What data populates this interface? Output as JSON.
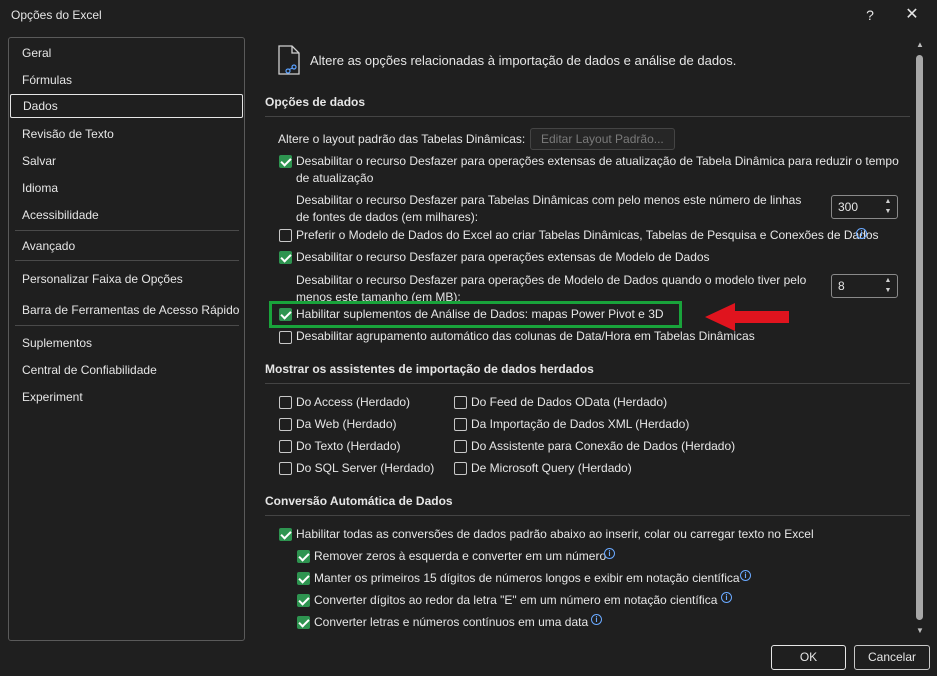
{
  "window": {
    "title": "Opções do Excel",
    "help_glyph": "?",
    "close_glyph": "✕"
  },
  "sidebar": {
    "items": [
      {
        "label": "Geral"
      },
      {
        "label": "Fórmulas"
      },
      {
        "label": "Dados",
        "active": true
      },
      {
        "label": "Revisão de Texto"
      },
      {
        "label": "Salvar"
      },
      {
        "label": "Idioma"
      },
      {
        "label": "Acessibilidade"
      },
      {
        "label": "Avançado"
      },
      {
        "label": "Personalizar Faixa de Opções"
      },
      {
        "label": "Barra de Ferramentas de Acesso Rápido"
      },
      {
        "label": "Suplementos"
      },
      {
        "label": "Central de Confiabilidade"
      },
      {
        "label": "Experiment"
      }
    ]
  },
  "main": {
    "intro": "Altere as opções relacionadas à importação de dados e análise de dados.",
    "data_options": {
      "heading": "Opções de dados",
      "pivot_layout_label": "Altere o layout padrão das Tabelas Dinâmicas:",
      "edit_layout_button": "Editar Layout Padrão...",
      "disable_undo_refresh": {
        "checked": true,
        "label": "Desabilitar o recurso Desfazer para operações extensas de atualização de Tabela Dinâmica para reduzir o tempo de atualização"
      },
      "disable_undo_rows_label": "Desabilitar o recurso Desfazer para Tabelas Dinâmicas com pelo menos este número de linhas de fontes de dados (em milhares):",
      "rows_value": "300",
      "prefer_data_model": {
        "checked": false,
        "label": "Preferir o Modelo de Dados do Excel ao criar Tabelas Dinâmicas, Tabelas de Pesquisa e Conexões de Dados"
      },
      "disable_undo_data_model": {
        "checked": true,
        "label": "Desabilitar o recurso Desfazer para operações extensas de Modelo de Dados"
      },
      "disable_undo_size_label": "Desabilitar o recurso Desfazer para operações de Modelo de Dados quando o modelo tiver pelo menos este tamanho (em MB):",
      "size_value": "8",
      "enable_addins": {
        "checked": true,
        "label": "Habilitar suplementos de Análise de Dados: mapas Power Pivot e 3D"
      },
      "disable_date_grouping": {
        "checked": false,
        "label": "Desabilitar agrupamento automático das colunas de Data/Hora em Tabelas Dinâmicas"
      }
    },
    "legacy_wizards": {
      "heading": "Mostrar os assistentes de importação de dados herdados",
      "left": [
        {
          "label": "Do Access (Herdado)",
          "checked": false
        },
        {
          "label": "Da Web (Herdado)",
          "checked": false
        },
        {
          "label": "Do Texto (Herdado)",
          "checked": false
        },
        {
          "label": "Do SQL Server (Herdado)",
          "checked": false
        }
      ],
      "right": [
        {
          "label": "Do Feed de Dados OData (Herdado)",
          "checked": false
        },
        {
          "label": "Da Importação de Dados XML (Herdado)",
          "checked": false
        },
        {
          "label": "Do Assistente para Conexão de Dados (Herdado)",
          "checked": false
        },
        {
          "label": "De Microsoft Query (Herdado)",
          "checked": false
        }
      ]
    },
    "auto_conversion": {
      "heading": "Conversão Automática de Dados",
      "enable_all": {
        "checked": true,
        "label": "Habilitar todas as conversões de dados padrão abaixo ao inserir, colar ou carregar texto no Excel"
      },
      "items": [
        {
          "checked": true,
          "label": "Remover zeros à esquerda e converter em um número"
        },
        {
          "checked": true,
          "label": "Manter os primeiros 15 dígitos de números longos e exibir em notação científica"
        },
        {
          "checked": true,
          "label": "Converter dígitos ao redor da letra \"E\" em um número em notação científica"
        },
        {
          "checked": true,
          "label": "Converter letras e números contínuos em uma data"
        }
      ]
    }
  },
  "footer": {
    "ok_label": "OK",
    "cancel_label": "Cancelar"
  },
  "colors": {
    "background": "#1f1f1f",
    "checkbox_checked": "#2e9450",
    "highlight_box": "#19a33b",
    "annotation_arrow": "#e0141e",
    "info_icon": "#6aa9ff"
  },
  "icons": {
    "intro": "document-data-icon",
    "info": "info-icon",
    "arrow": "red-arrow-left"
  }
}
